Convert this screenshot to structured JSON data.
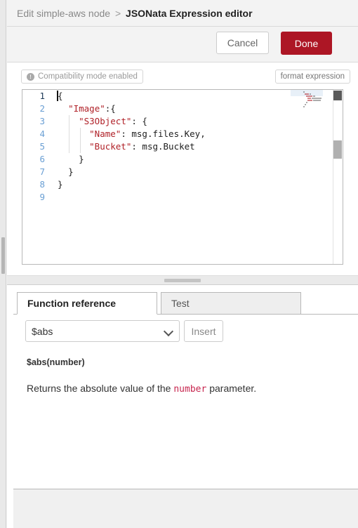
{
  "header": {
    "breadcrumb_parent": "Edit simple-aws node",
    "breadcrumb_separator": ">",
    "breadcrumb_current": "JSONata Expression editor"
  },
  "toolbar": {
    "cancel_label": "Cancel",
    "done_label": "Done",
    "done_color": "#ad1625"
  },
  "editor_toolbar": {
    "compatibility_badge": "Compatibility mode enabled",
    "compatibility_icon": "info-circle-icon",
    "format_expression_label": "format expression"
  },
  "editor": {
    "language": "jsonata",
    "active_line": 1,
    "line_numbers": [
      "1",
      "2",
      "3",
      "4",
      "5",
      "6",
      "7",
      "8",
      "9"
    ],
    "lines": [
      {
        "indent": 0,
        "tokens": [
          {
            "text": "{",
            "type": "plain"
          }
        ]
      },
      {
        "indent": 1,
        "tokens": [
          {
            "text": "\"Image\"",
            "type": "key"
          },
          {
            "text": ":{",
            "type": "plain"
          }
        ]
      },
      {
        "indent": 2,
        "tokens": [
          {
            "text": "\"S3Object\"",
            "type": "key"
          },
          {
            "text": ": {",
            "type": "plain"
          }
        ]
      },
      {
        "indent": 3,
        "tokens": [
          {
            "text": "\"Name\"",
            "type": "key"
          },
          {
            "text": ": msg.files.Key,",
            "type": "plain"
          }
        ]
      },
      {
        "indent": 3,
        "tokens": [
          {
            "text": "\"Bucket\"",
            "type": "key"
          },
          {
            "text": ": msg.Bucket",
            "type": "plain"
          }
        ]
      },
      {
        "indent": 2,
        "tokens": [
          {
            "text": "}",
            "type": "plain"
          }
        ]
      },
      {
        "indent": 1,
        "tokens": [
          {
            "text": "}",
            "type": "plain"
          }
        ]
      },
      {
        "indent": 0,
        "tokens": [
          {
            "text": "}",
            "type": "plain"
          }
        ]
      },
      {
        "indent": 0,
        "tokens": []
      }
    ],
    "key_color": "#b02128",
    "text_color": "#1e1e1e",
    "line_number_color": "#6a9fd4"
  },
  "tabs": [
    {
      "id": "function-reference",
      "label": "Function reference",
      "selected": true
    },
    {
      "id": "test",
      "label": "Test",
      "selected": false
    }
  ],
  "function_reference": {
    "selected_function": "$abs",
    "insert_label": "Insert",
    "signature": "$abs(number)",
    "description_before": "Returns the absolute value of the ",
    "description_code": "number",
    "description_after": " parameter."
  }
}
